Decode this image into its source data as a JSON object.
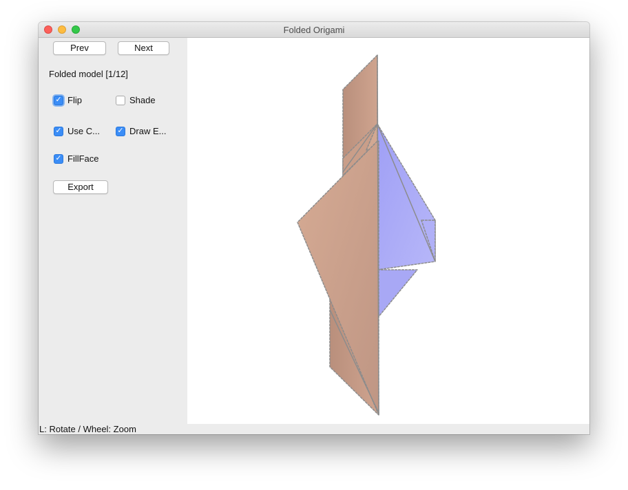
{
  "window": {
    "title": "Folded Origami"
  },
  "sidebar": {
    "prev_label": "Prev",
    "next_label": "Next",
    "model_label": "Folded model [1/12]",
    "checkboxes": {
      "flip": {
        "label": "Flip",
        "checked": true
      },
      "shade": {
        "label": "Shade",
        "checked": false
      },
      "use_c": {
        "label": "Use C...",
        "checked": true
      },
      "draw_e": {
        "label": "Draw E...",
        "checked": true
      },
      "fill_face": {
        "label": "FillFace",
        "checked": true
      }
    },
    "export_label": "Export"
  },
  "status": {
    "hint": "L: Rotate / Wheel: Zoom"
  },
  "colors": {
    "front_face": "#c9a08a",
    "back_face": "#a9a9f6",
    "edge": "#8c8c8c",
    "checkbox_on": "#3b8df6"
  },
  "icons": {
    "check": "checkmark-icon"
  }
}
